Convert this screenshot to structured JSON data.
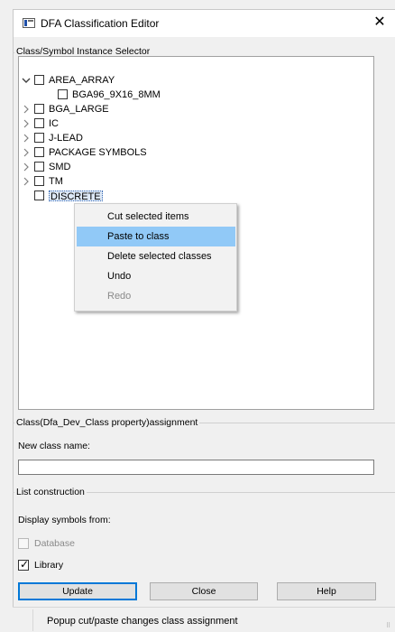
{
  "window": {
    "title": "DFA Classification Editor",
    "close_glyph": "✕"
  },
  "selector": {
    "group_title": "Class/Symbol Instance Selector",
    "tree": [
      {
        "label": "AREA_ARRAY",
        "expander": "expanded"
      },
      {
        "label": "BGA96_9X16_8MM",
        "expander": "none"
      },
      {
        "label": "BGA_LARGE",
        "expander": "collapsed"
      },
      {
        "label": "IC",
        "expander": "collapsed"
      },
      {
        "label": "J-LEAD",
        "expander": "collapsed"
      },
      {
        "label": "PACKAGE SYMBOLS",
        "expander": "collapsed"
      },
      {
        "label": "SMD",
        "expander": "collapsed"
      },
      {
        "label": "TM",
        "expander": "collapsed"
      },
      {
        "label": "DISCRETE",
        "expander": "none",
        "selected": true
      }
    ]
  },
  "context_menu": {
    "items": [
      {
        "label": "Cut selected items",
        "state": "normal"
      },
      {
        "label": "Paste to class",
        "state": "hover"
      },
      {
        "label": "Delete selected classes",
        "state": "normal"
      },
      {
        "label": "Undo",
        "state": "normal"
      },
      {
        "label": "Redo",
        "state": "disabled"
      }
    ]
  },
  "assignment": {
    "group_title": "Class(Dfa_Dev_Class property)assignment",
    "new_class_label": "New class name:",
    "new_class_value": ""
  },
  "list_construction": {
    "group_title": "List construction",
    "display_label": "Display symbols from:",
    "database": {
      "label": "Database",
      "checked": false,
      "enabled": false
    },
    "library": {
      "label": "Library",
      "checked": true,
      "enabled": true
    }
  },
  "buttons": {
    "update": "Update",
    "close": "Close",
    "help": "Help"
  },
  "status": {
    "text": "Popup cut/paste changes class assignment"
  },
  "icons": {
    "app": "dfa-editor-app-icon",
    "expand": "chevron-down-icon",
    "collapse": "chevron-right-icon",
    "grip": "resize-grip-icon"
  },
  "colors": {
    "menu_hover": "#91c9f7",
    "default_button_border": "#0078d7",
    "selection": "#dde8f6"
  }
}
